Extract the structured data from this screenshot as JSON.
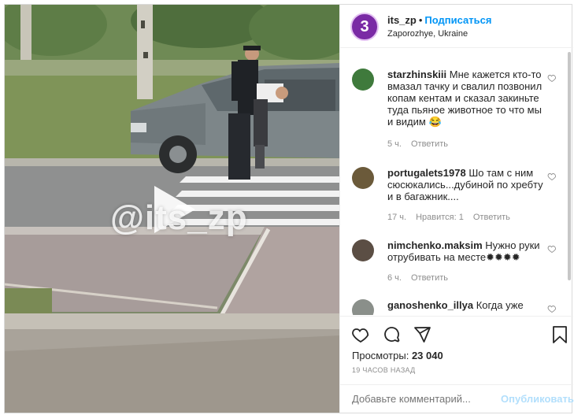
{
  "post": {
    "watermark": "@its_zp",
    "account": {
      "username": "its_zp",
      "separator": "•",
      "follow_label": "Подписаться",
      "location": "Zaporozhye, Ukraine",
      "avatar_glyph": "3"
    },
    "comments": [
      {
        "username": "starzhinskiii",
        "text": "Мне кажется кто-то вмазал тачку и свалил позвонил копам кентам и сказал закиньте туда пьяное животное то что мы и видим 😂",
        "time": "5 ч.",
        "likes": "",
        "reply_label": "Ответить"
      },
      {
        "username": "portugalets1978",
        "text": "Шо там с ним сюсюкались...дубиной по хребту и в багажник....",
        "time": "17 ч.",
        "likes": "Нравится: 1",
        "reply_label": "Ответить"
      },
      {
        "username": "nimchenko.maksim",
        "text": "Нужно руки отрубивать на месте✹✹✹✹",
        "time": "6 ч.",
        "likes": "",
        "reply_label": "Ответить"
      },
      {
        "username": "ganoshenko_illya",
        "text": "Когда уже",
        "time": "",
        "likes": "",
        "reply_label": ""
      }
    ],
    "icons": {
      "like": "heart-icon",
      "comment": "comment-icon",
      "share": "share-icon",
      "save": "bookmark-icon"
    },
    "views_label": "Просмотры:",
    "views_count": "23 040",
    "timestamp": "19 ЧАСОВ НАЗАД",
    "add_comment_placeholder": "Добавьте комментарий...",
    "publish_label": "Опубликовать",
    "colors": {
      "accent": "#0095f6",
      "publish_disabled": "#b2dffc",
      "avatar_brand": "#7a2aa5"
    }
  }
}
